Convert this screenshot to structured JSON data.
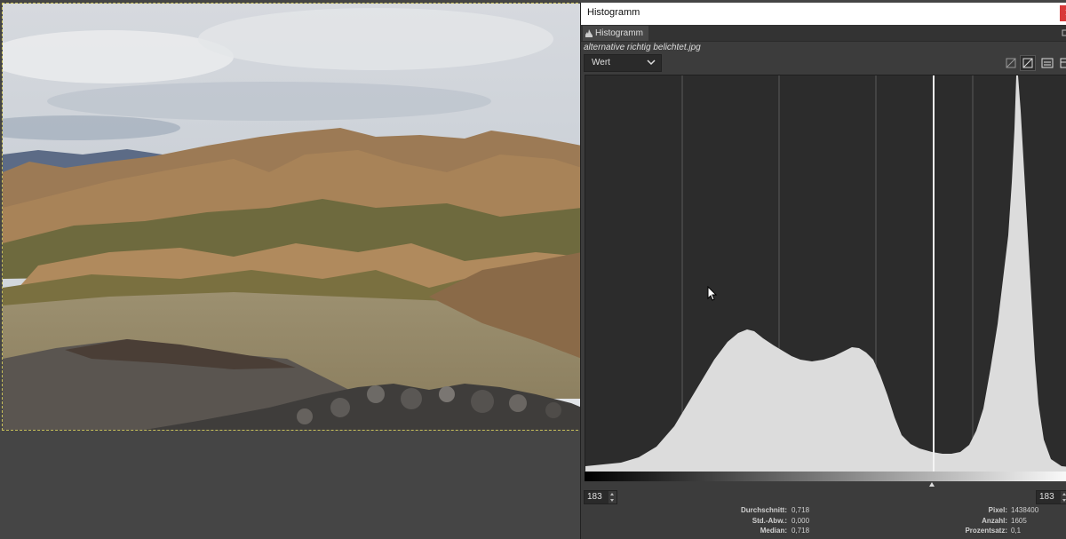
{
  "dialog": {
    "title": "Histogramm",
    "tab_label": "Histogramm",
    "filename": "alternative richtig belichtet.jpg",
    "channel": "Wert"
  },
  "icons": {
    "close": "close-icon",
    "tab": "histogram-icon",
    "chevron": "chevron-down-icon",
    "linear": "linear-scale-icon",
    "log": "logarithmic-scale-icon",
    "tool3": "settings-icon",
    "tool4": "panel-icon"
  },
  "range": {
    "start": "183",
    "end": "183"
  },
  "stats": {
    "left": [
      {
        "label": "Durchschnitt:",
        "value": "0,718"
      },
      {
        "label": "Std.-Abw.:",
        "value": "0,000"
      },
      {
        "label": "Median:",
        "value": "0,718"
      }
    ],
    "right": [
      {
        "label": "Pixel:",
        "value": "1438400"
      },
      {
        "label": "Anzahl:",
        "value": "1605"
      },
      {
        "label": "Prozentsatz:",
        "value": "0,1"
      }
    ]
  },
  "colors": {
    "histogram_fill": "#dcdcdc",
    "background": "#2c2c2c",
    "gridline": "#555555",
    "close_button": "#d9393a"
  }
}
